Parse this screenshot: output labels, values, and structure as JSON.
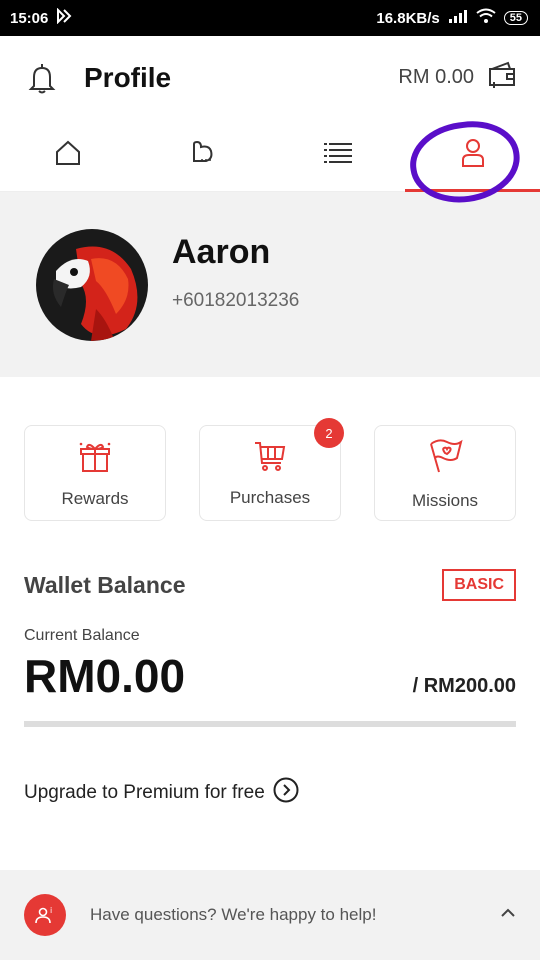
{
  "status_bar": {
    "time": "15:06",
    "network_speed": "16.8KB/s",
    "battery": "55"
  },
  "header": {
    "title": "Profile",
    "wallet_amount": "RM 0.00"
  },
  "tabs": [
    {
      "name": "home",
      "icon": "home-icon",
      "active": false
    },
    {
      "name": "deals",
      "icon": "chat-bubble-icon",
      "active": false
    },
    {
      "name": "list",
      "icon": "list-icon",
      "active": false
    },
    {
      "name": "profile",
      "icon": "user-icon",
      "active": true
    }
  ],
  "profile": {
    "name": "Aaron",
    "phone": "+60182013236"
  },
  "shortcuts": [
    {
      "label": "Rewards",
      "icon": "gift-icon"
    },
    {
      "label": "Purchases",
      "icon": "cart-icon",
      "badge": "2"
    },
    {
      "label": "Missions",
      "icon": "flag-icon"
    }
  ],
  "wallet": {
    "title": "Wallet Balance",
    "tier": "BASIC",
    "current_label": "Current Balance",
    "balance": "RM0.00",
    "limit": "/ RM200.00",
    "progress_fraction": 0
  },
  "upgrade": {
    "text": "Upgrade to Premium for free"
  },
  "help": {
    "text": "Have questions? We're happy to help!"
  },
  "colors": {
    "accent": "#e53935",
    "annotation": "#5a0ec9"
  }
}
